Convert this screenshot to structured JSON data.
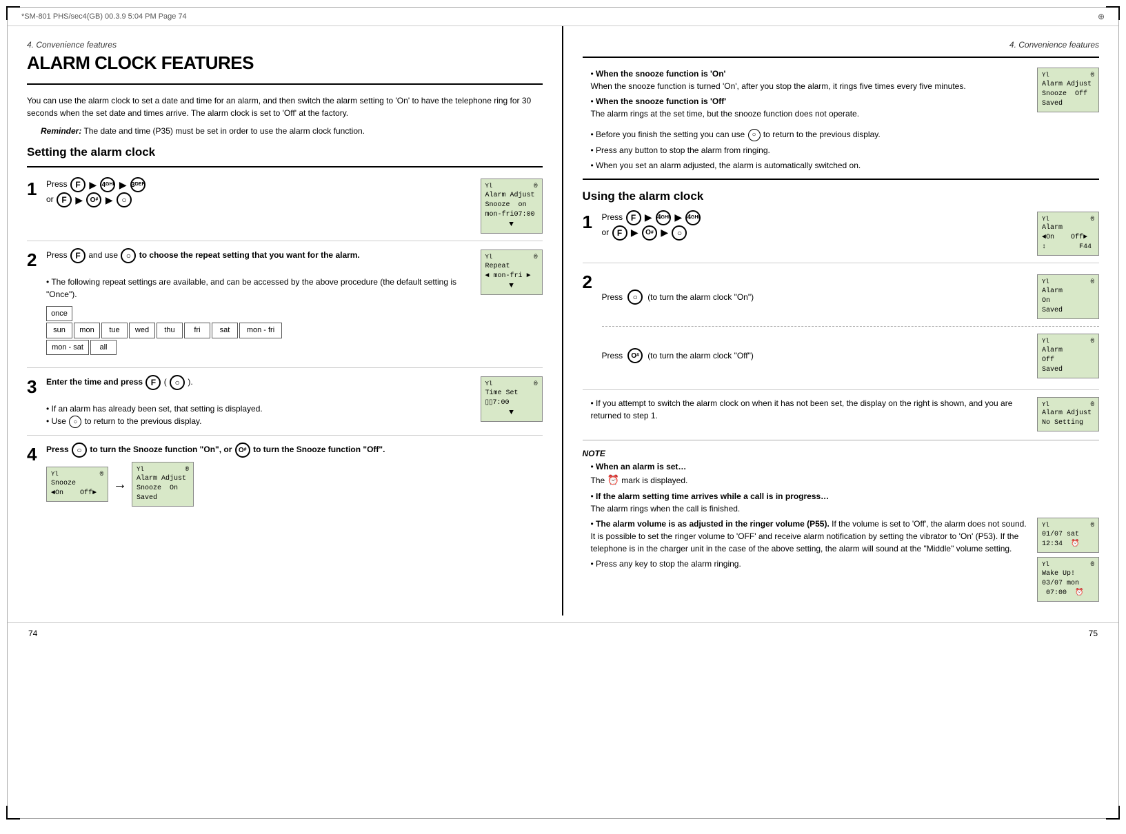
{
  "meta": {
    "top_file": "*SM-801 PHS/sec4(GB)  00.3.9 5:04 PM  Page 74",
    "section_left": "4. Convenience features",
    "section_right": "4. Convenience features",
    "page_left": "74",
    "page_right": "75"
  },
  "left": {
    "section_meta": "4. Convenience features",
    "section_title": "ALARM CLOCK FEATURES",
    "intro": "You can use the alarm clock to set a date and time for an alarm, and then switch the alarm setting to 'On' to have the telephone ring for 30 seconds when the set date and times arrive. The alarm clock is set to 'Off' at the factory.",
    "reminder_label": "Reminder:",
    "reminder_text": "The date and time (P35) must be set in order to use the alarm clock function.",
    "subsection": "Setting the alarm clock",
    "steps": [
      {
        "number": "1",
        "text": "Press",
        "buttons": [
          "F",
          "4GHI",
          "3DEF"
        ],
        "or_buttons": [
          "F",
          "O#",
          "O"
        ],
        "display": {
          "signal": "Yl",
          "icon": "®",
          "lines": [
            "Alarm Adjust",
            "Snooze  on",
            "mon-fri07:00"
          ],
          "arrow": "▼"
        }
      },
      {
        "number": "2",
        "text": "Press",
        "button": "F",
        "and_text": "and use",
        "button2": "O",
        "bold_text": "to choose the repeat setting that you want for the alarm.",
        "sub_text": "The following repeat settings are available, and can be accessed by the above procedure (the default setting is \"Once\").",
        "repeat_row1": [
          "once"
        ],
        "repeat_row2": [
          "sun",
          "mon",
          "tue",
          "wed",
          "thu",
          "fri",
          "sat",
          "mon - fri"
        ],
        "repeat_row3": [
          "mon - sat",
          "all"
        ],
        "display": {
          "signal": "Yl",
          "icon": "®",
          "lines": [
            "Repeat",
            "◄ mon-fri ►"
          ],
          "arrow": "▼"
        }
      },
      {
        "number": "3",
        "bold_text": "Enter the time and press",
        "button": "F",
        "paren_button": "O",
        "bullets": [
          "If an alarm has already been set, that setting is displayed.",
          "Use      to return to the previous display."
        ],
        "display": {
          "signal": "Yl",
          "icon": "®",
          "lines": [
            "Time Set",
            "▯▯7:00"
          ],
          "arrow": "▼"
        }
      },
      {
        "number": "4",
        "bold_text": "Press      to turn the Snooze function \"On\", or      to turn the Snooze function \"Off\".",
        "display1": {
          "signal": "Yl",
          "icon": "®",
          "lines": [
            "Snooze",
            "◄On    Off►"
          ]
        },
        "arrow": "→",
        "display2": {
          "signal": "Yl",
          "icon": "®",
          "lines": [
            "Alarm Adjust",
            "Snooze  On",
            "Saved"
          ]
        }
      }
    ]
  },
  "right": {
    "section_meta": "4. Convenience features",
    "snooze_bullets": [
      {
        "bold": "When the snooze function is 'On'",
        "text": "When the snooze function is turned 'On', after you stop the alarm, it rings five times every five minutes."
      },
      {
        "bold": "When the snooze function is 'Off'",
        "text": "The alarm rings at the set time, but the snooze function does not operate."
      },
      {
        "text": "Before you finish the setting you can use      to return to the previous display."
      },
      {
        "text": "Press any button to stop the alarm from ringing."
      },
      {
        "text": "When you set an alarm adjusted, the alarm is automatically switched on."
      }
    ],
    "snooze_display": {
      "signal": "Yl",
      "icon": "®",
      "lines": [
        "Alarm Adjust",
        "Snooze  Off",
        "Saved"
      ]
    },
    "subsection": "Using the alarm clock",
    "steps": [
      {
        "number": "1",
        "text": "Press",
        "buttons": [
          "F",
          "4GHI",
          "4GHI"
        ],
        "or_buttons": [
          "F",
          "O#",
          "O"
        ],
        "display": {
          "signal": "Yl",
          "icon": "®",
          "lines": [
            "Alarm",
            "◄On    Off►",
            "↕        F44"
          ]
        }
      },
      {
        "number": "2",
        "press_on_text": "Press",
        "button": "O",
        "on_text": "(to turn the alarm clock \"On\")",
        "display_on": {
          "signal": "Yl",
          "icon": "®",
          "lines": [
            "Alarm",
            "On",
            "Saved"
          ]
        },
        "press_off_text": "Press",
        "button_off": "O#",
        "off_text": "(to turn the alarm clock \"Off\")",
        "display_off": {
          "signal": "Yl",
          "icon": "®",
          "lines": [
            "Alarm",
            "Off",
            "Saved"
          ]
        }
      }
    ],
    "no_setting_bullet": "If you attempt to switch the alarm clock on when it has not been set, the display on the right is shown, and you are returned to step 1.",
    "no_setting_display": {
      "signal": "Yl",
      "icon": "®",
      "lines": [
        "Alarm Adjust",
        "No Setting"
      ]
    },
    "note_title": "NOTE",
    "notes": [
      {
        "bold": "When an alarm is set…",
        "text": "The      mark is displayed."
      },
      {
        "bold": "If the alarm setting time arrives while a call is in progress…",
        "text": "The alarm rings when the call is finished."
      },
      {
        "bold": "The alarm volume is as adjusted in the ringer volume (P55).",
        "text": "If the volume is set to 'Off', the alarm does not sound. It is possible to set the ringer volume to 'OFF' and receive alarm notification by setting the vibrator to 'On' (P53). If the telephone is in the charger unit in the case of the above setting, the alarm will sound at the \"Middle\" volume setting."
      },
      {
        "text": "Press any key to stop the alarm ringing."
      }
    ],
    "display_time": {
      "signal": "Yl",
      "icon": "®",
      "lines": [
        "01/07 sat",
        "12:34  ⏰"
      ]
    },
    "display_wakeup": {
      "signal": "Yl",
      "icon": "®",
      "lines": [
        "Wake Up!",
        "03/07 mon",
        " 07:00  ⏰"
      ]
    }
  }
}
